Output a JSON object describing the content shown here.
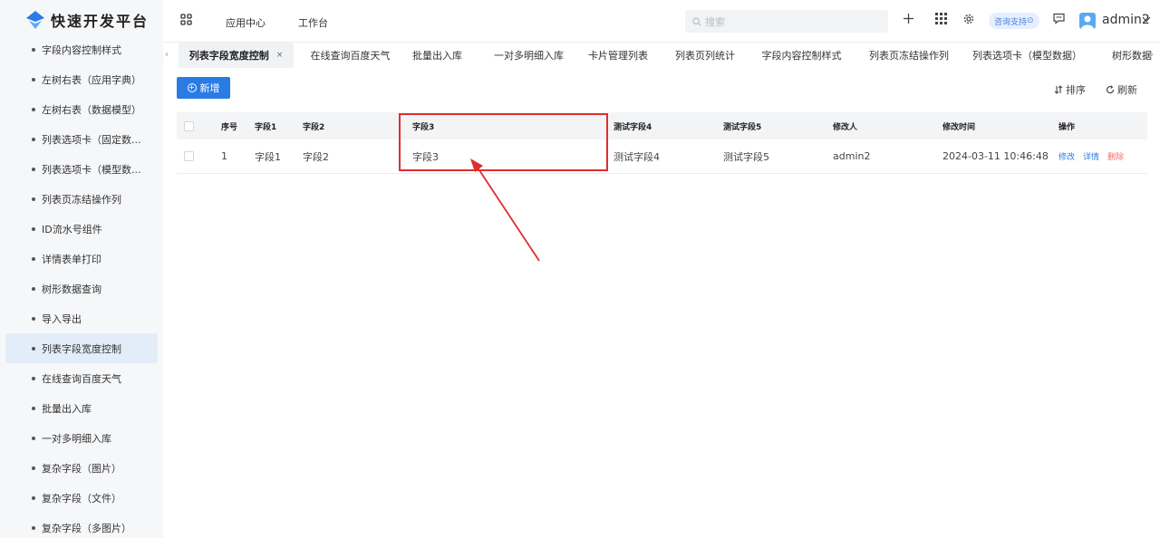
{
  "app": {
    "title": "快速开发平台"
  },
  "header": {
    "nav": [
      "应用中心",
      "工作台"
    ],
    "search_placeholder": "搜索",
    "support_label": "咨询支持",
    "username": "admin2"
  },
  "sidebar": {
    "items": [
      {
        "label": "字段内容控制样式"
      },
      {
        "label": "左树右表（应用字典）"
      },
      {
        "label": "左树右表（数据模型）"
      },
      {
        "label": "列表选项卡（固定数..."
      },
      {
        "label": "列表选项卡（模型数..."
      },
      {
        "label": "列表页冻结操作列"
      },
      {
        "label": "ID流水号组件"
      },
      {
        "label": "详情表单打印"
      },
      {
        "label": "树形数据查询"
      },
      {
        "label": "导入导出"
      },
      {
        "label": "列表字段宽度控制",
        "active": true
      },
      {
        "label": "在线查询百度天气"
      },
      {
        "label": "批量出入库"
      },
      {
        "label": "一对多明细入库"
      },
      {
        "label": "复杂字段（图片）"
      },
      {
        "label": "复杂字段（文件）"
      },
      {
        "label": "复杂字段（多图片）"
      }
    ]
  },
  "tabs": [
    {
      "label": "列表字段宽度控制",
      "active": true
    },
    {
      "label": "在线查询百度天气"
    },
    {
      "label": "批量出入库"
    },
    {
      "label": "一对多明细入库"
    },
    {
      "label": "卡片管理列表"
    },
    {
      "label": "列表页列统计"
    },
    {
      "label": "字段内容控制样式"
    },
    {
      "label": "列表页冻结操作列"
    },
    {
      "label": "列表选项卡（模型数据）"
    },
    {
      "label": "树形数据"
    }
  ],
  "toolbar": {
    "new_label": "新增",
    "sort_label": "排序",
    "refresh_label": "刷新"
  },
  "table": {
    "columns": [
      "序号",
      "字段1",
      "字段2",
      "字段3",
      "测试字段4",
      "测试字段5",
      "修改人",
      "修改时间",
      "操作"
    ],
    "rows": [
      {
        "cells": [
          "1",
          "字段1",
          "字段2",
          "字段3",
          "测试字段4",
          "测试字段5",
          "admin2",
          "2024-03-11 10:46:48"
        ],
        "actions": [
          "修改",
          "详情",
          "删除"
        ]
      }
    ]
  },
  "colors": {
    "primary": "#2a7be4",
    "danger": "#f56c6c",
    "annotation": "#e02d2d",
    "active_menu_bg": "#e3edf9"
  }
}
